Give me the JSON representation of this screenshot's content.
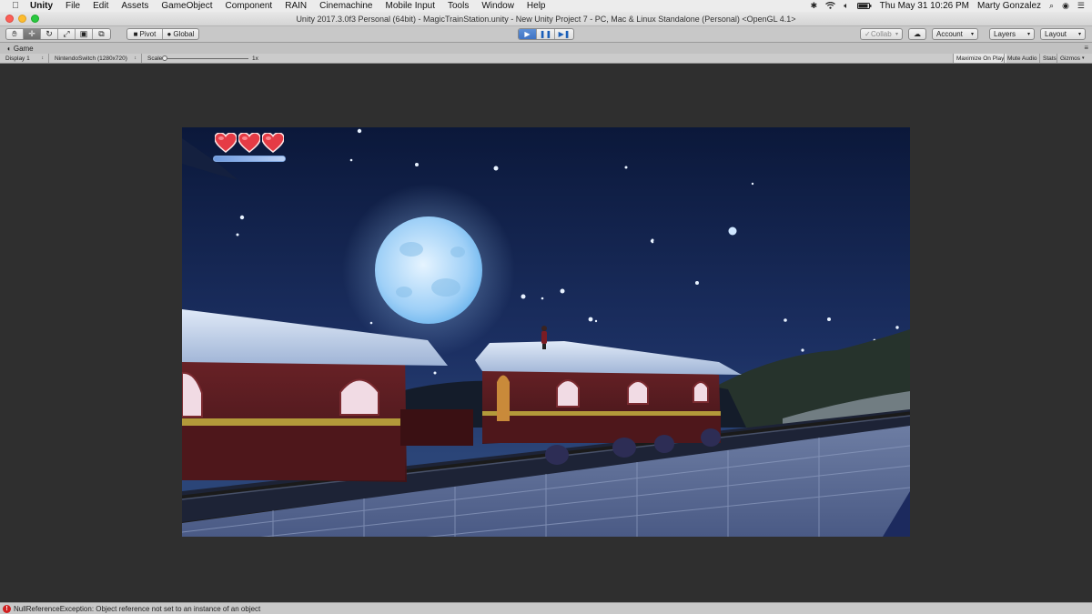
{
  "menubar": {
    "apple_icon": "apple-logo-icon",
    "app_name": "Unity",
    "items": [
      "File",
      "Edit",
      "Assets",
      "GameObject",
      "Component",
      "RAIN",
      "Cinemachine",
      "Mobile Input",
      "Tools",
      "Window",
      "Help"
    ],
    "datetime": "Thu May 31  10:26 PM",
    "user": "Marty Gonzalez"
  },
  "window": {
    "title": "Unity 2017.3.0f3 Personal (64bit) - MagicTrainStation.unity - New Unity Project 7 - PC, Mac & Linux Standalone (Personal) <OpenGL 4.1>"
  },
  "toolbar": {
    "pivot_label": "Pivot",
    "global_label": "Global",
    "collab_label": "Collab",
    "account_label": "Account",
    "layers_label": "Layers",
    "layout_label": "Layout"
  },
  "game_view": {
    "tab_label": "Game",
    "display_label": "Display 1",
    "resolution_label": "NintendoSwitch (1280x720)",
    "scale_label": "Scale",
    "scale_value": "1x",
    "scale_fraction": 0.0,
    "maximize_label": "Maximize On Play",
    "mute_label": "Mute Audio",
    "stats_label": "Stats",
    "gizmos_label": "Gizmos"
  },
  "hud": {
    "hearts": 3,
    "energy_fraction": 1.0
  },
  "console": {
    "error_message": "NullReferenceException: Object reference not set to an instance of an object"
  },
  "colors": {
    "play_active": "#4a80cf",
    "error": "#d02020",
    "sky_top": "#0d1b3e",
    "moon": "#bfe0ff",
    "roof_snow": "#c7d6ec",
    "train_body": "#5a1c20"
  }
}
